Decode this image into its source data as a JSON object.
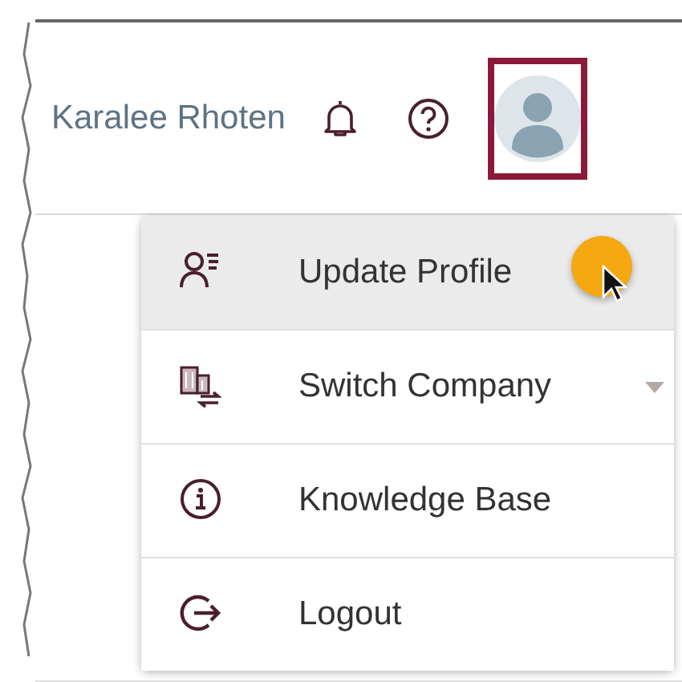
{
  "header": {
    "user_name": "Karalee Rhoten",
    "avatar_selected": true
  },
  "menu": {
    "items": [
      {
        "label": "Update Profile",
        "kind": "profile",
        "hovered": true,
        "has_submenu": false
      },
      {
        "label": "Switch Company",
        "kind": "switch",
        "hovered": false,
        "has_submenu": true
      },
      {
        "label": "Knowledge Base",
        "kind": "info",
        "hovered": false,
        "has_submenu": false
      },
      {
        "label": "Logout",
        "kind": "logout",
        "hovered": false,
        "has_submenu": false
      }
    ]
  }
}
